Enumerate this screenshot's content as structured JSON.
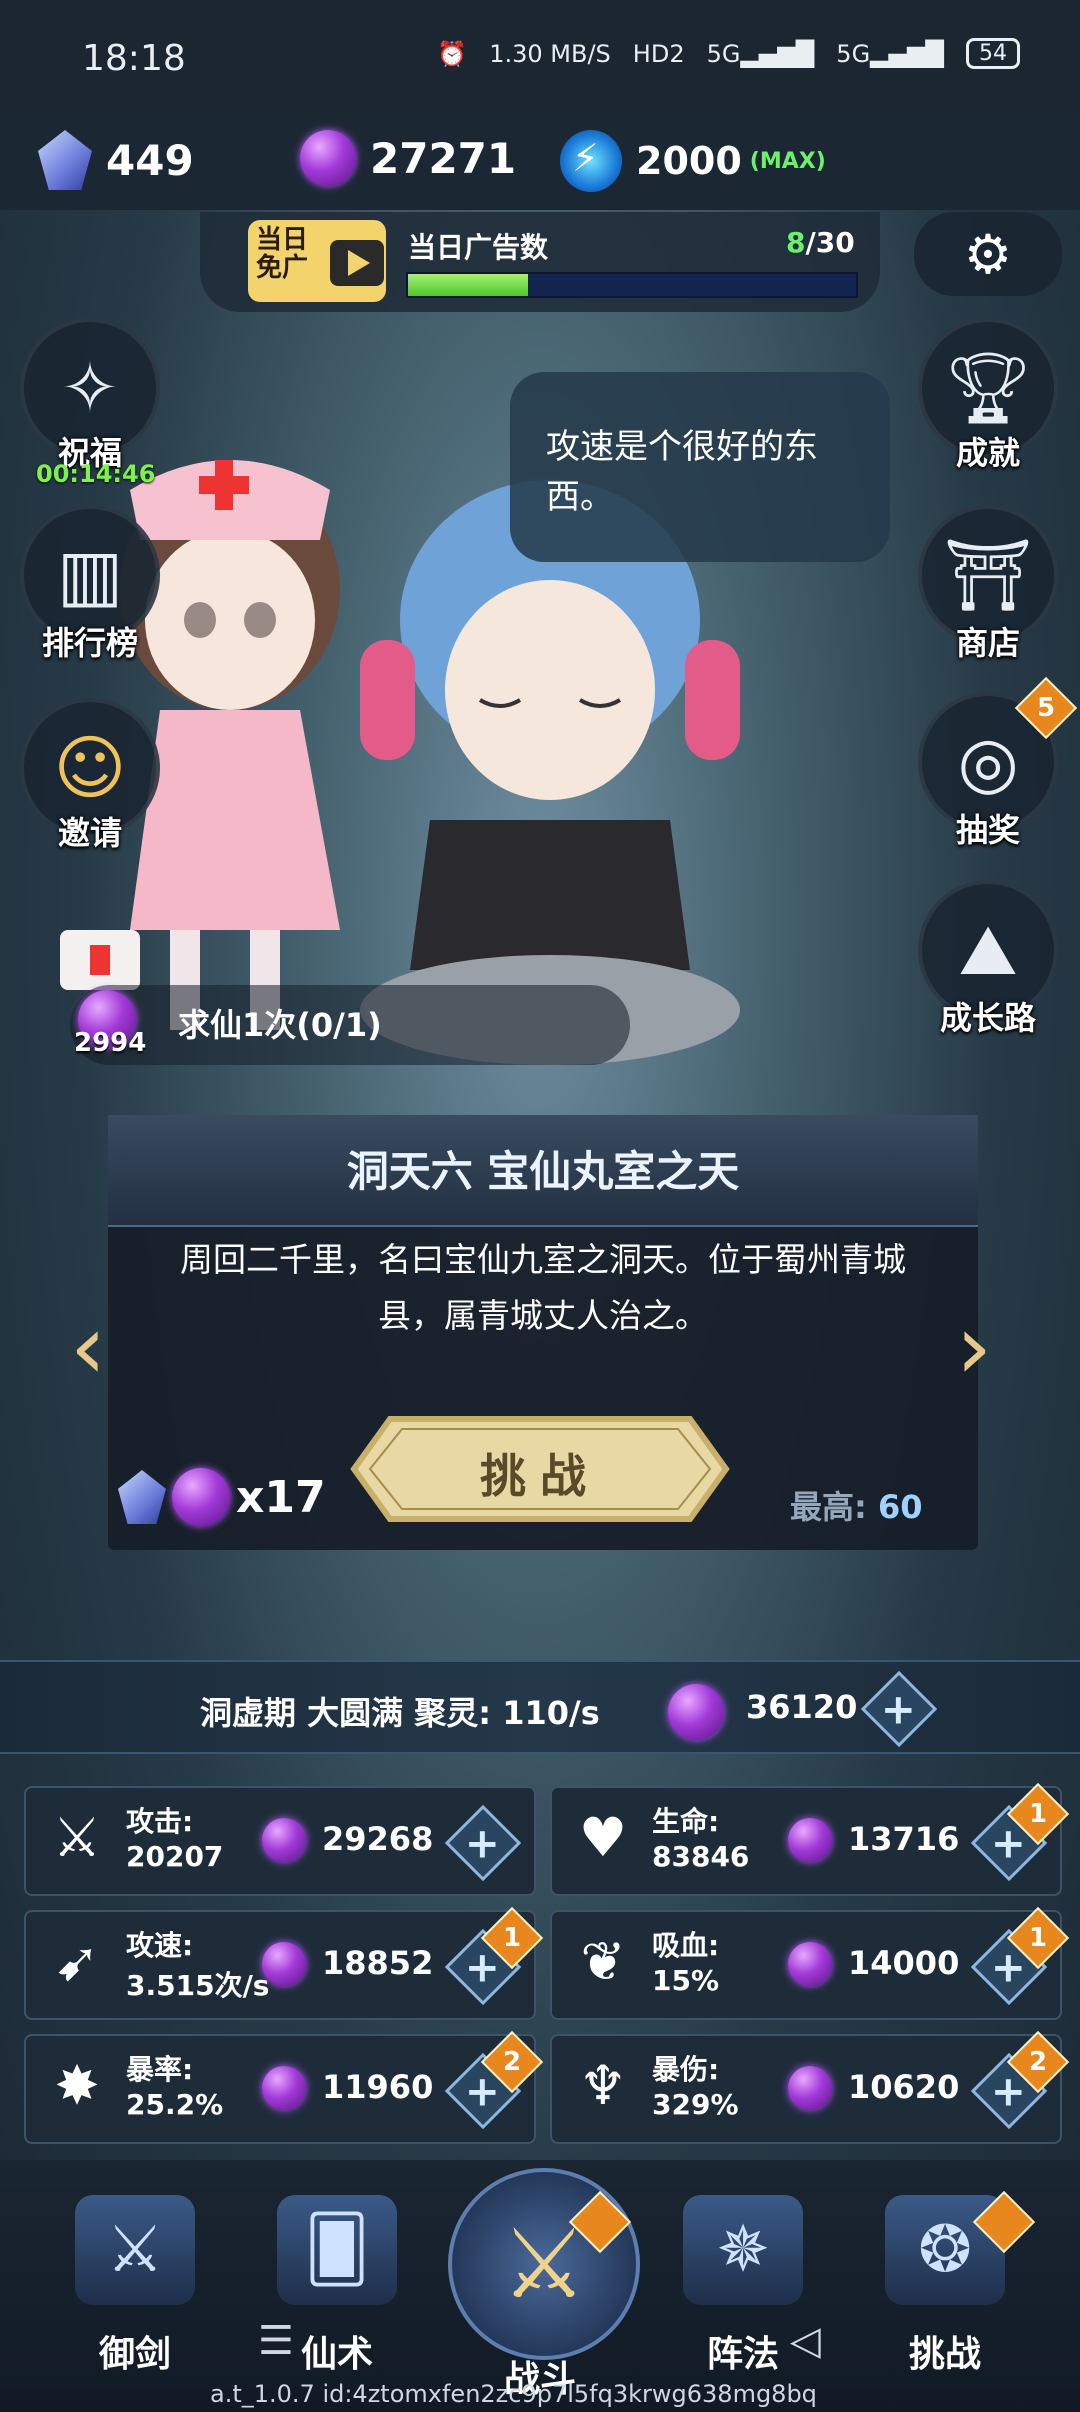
{
  "status": {
    "time": "18:18",
    "net_speed": "1.30 MB/S",
    "hd": "HD2",
    "net1": "5G",
    "net2": "5G",
    "battery": "54"
  },
  "resources": {
    "crystal": "449",
    "spirit_orbs": "27271",
    "energy": "2000",
    "energy_max": "(MAX)"
  },
  "ad": {
    "badge_line1": "当日",
    "badge_line2": "免广",
    "label": "当日广告数",
    "current": "8",
    "total": "/30",
    "progress": 0.267
  },
  "left_buttons": [
    {
      "label": "祝福",
      "timer": "00:14:46",
      "icon": "compass-icon"
    },
    {
      "label": "排行榜",
      "icon": "podium-icon"
    },
    {
      "label": "邀请",
      "icon": "invite-icon"
    }
  ],
  "right_buttons": [
    {
      "label": "成就",
      "icon": "trophy-icon"
    },
    {
      "label": "商店",
      "icon": "shop-icon"
    },
    {
      "label": "抽奖",
      "icon": "lottery-icon",
      "badge": "5"
    },
    {
      "label": "成长路",
      "icon": "mountain-icon"
    }
  ],
  "speech": "攻速是个很好的东西。",
  "quest": {
    "label": "求仙1次(0/1)",
    "orb_count": "2994"
  },
  "stage": {
    "title": "洞天六 宝仙丸室之天",
    "description": "周回二千里，名曰宝仙九室之洞天。位于蜀州青城县，属青城丈人治之。",
    "button": "挑战",
    "cost": "x17",
    "best_label": "最高:",
    "best_value": "60"
  },
  "realm": {
    "text": "洞虚期 大圆满 聚灵: 110/s",
    "orbs": "36120"
  },
  "stats": [
    {
      "name": "攻击:",
      "value": "20207",
      "cost": "29268",
      "badge": "",
      "icon": "sword-icon"
    },
    {
      "name": "生命:",
      "value": "83846",
      "cost": "13716",
      "badge": "1",
      "icon": "heart-icon"
    },
    {
      "name": "攻速:",
      "value": "3.515次/s",
      "cost": "18852",
      "badge": "1",
      "icon": "speed-icon"
    },
    {
      "name": "吸血:",
      "value": "15%",
      "cost": "14000",
      "badge": "1",
      "icon": "lifesteal-icon"
    },
    {
      "name": "暴率:",
      "value": "25.2%",
      "cost": "11960",
      "badge": "2",
      "icon": "crit-rate-icon"
    },
    {
      "name": "暴伤:",
      "value": "329%",
      "cost": "10620",
      "badge": "2",
      "icon": "crit-damage-icon"
    }
  ],
  "nav": [
    {
      "label": "御剑",
      "icon": "flying-sword-icon"
    },
    {
      "label": "仙术",
      "icon": "spell-card-icon"
    },
    {
      "label": "战斗",
      "icon": "battle-icon"
    },
    {
      "label": "阵法",
      "icon": "formation-icon"
    },
    {
      "label": "挑战",
      "icon": "challenge-icon"
    }
  ],
  "version": "a.t_1.0.7 id:4ztomxfen2zc9p7l5fq3krwg638mg8bq"
}
